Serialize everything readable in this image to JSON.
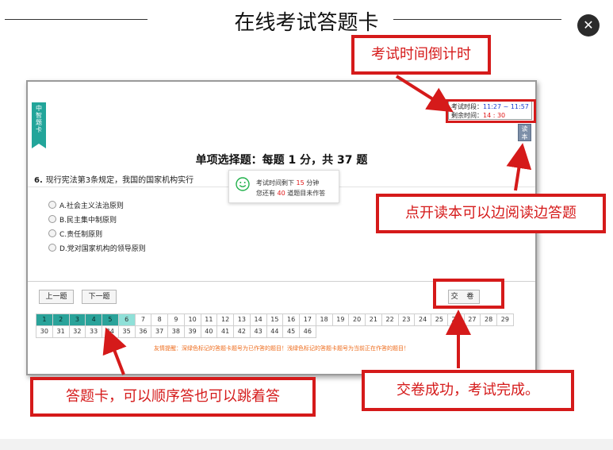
{
  "title": "在线考试答题卡",
  "close_symbol": "✕",
  "side_tab": [
    "中",
    "智",
    "题",
    "卡"
  ],
  "timer": {
    "period_label": "考试时段：",
    "period_value": "11:27 ~ 11:57",
    "remaining_label": "剩余时间：",
    "remaining_value": "14 : 30"
  },
  "read_button": [
    "读",
    "本"
  ],
  "section_title": "单项选择题：每题 1 分，共 37 题",
  "question": {
    "number": "6.",
    "text": "现行宪法第3条规定，我国的国家机构实行",
    "options": [
      "A.社会主义法治原则",
      "B.民主集中制原则",
      "C.责任制原则",
      "D.党对国家机构的领导原则"
    ]
  },
  "popup": {
    "line1_pre": "考试时间剩下",
    "line1_num": "15",
    "line1_post": "分钟",
    "line2_pre": "您还有",
    "line2_num": "40",
    "line2_post": "道题目未作答"
  },
  "buttons": {
    "prev": "上一题",
    "next": "下一题",
    "submit": "交 卷"
  },
  "answer_grid": {
    "numbers": [
      1,
      2,
      3,
      4,
      5,
      6,
      7,
      8,
      9,
      10,
      11,
      12,
      13,
      14,
      15,
      16,
      17,
      18,
      19,
      20,
      21,
      22,
      23,
      24,
      25,
      26,
      27,
      28,
      29,
      30,
      31,
      32,
      33,
      34,
      35,
      36,
      37,
      38,
      39,
      40,
      41,
      42,
      43,
      44,
      45,
      46
    ],
    "answered": [
      1,
      2,
      3,
      4,
      5
    ],
    "current": 6,
    "note": "友情提醒：深绿色标记的答题卡题号为已作答的题目！浅绿色标记的答题卡题号为当前正在作答的题目！"
  },
  "callouts": {
    "timer": "考试时间倒计时",
    "read": "点开读本可以边阅读边答题",
    "grid": "答题卡，可以顺序答也可以跳着答",
    "submit": "交卷成功，考试完成。"
  },
  "colors": {
    "accent_red": "#d51a1a",
    "teal": "#2aa39a",
    "light_teal": "#8fe0d8"
  }
}
